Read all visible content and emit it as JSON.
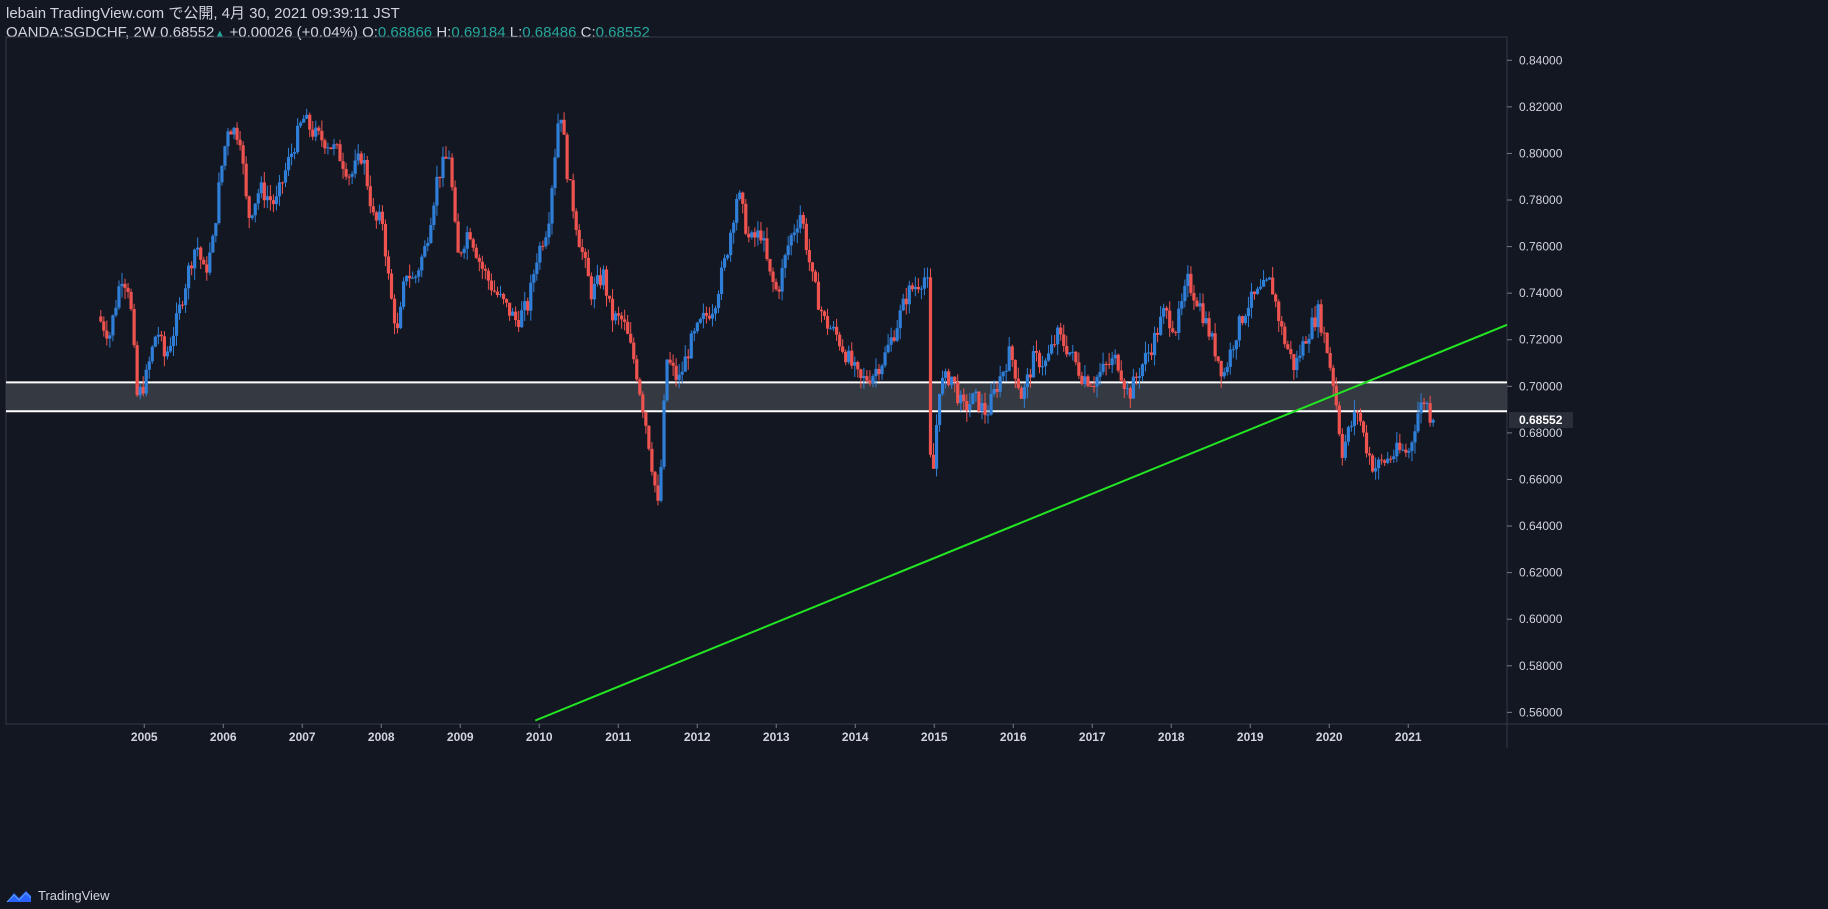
{
  "header": {
    "publisher": "lebain TradingView.com で公開, 4月 30, 2021 09:39:11 JST",
    "symbol_interval_price": "OANDA:SGDCHF, 2W 0.68552",
    "change": "+0.00026 (+0.04%)",
    "open_label": "O:",
    "open_value": "0.68866",
    "high_label": "H:",
    "high_value": "0.69184",
    "low_label": "L:",
    "low_value": "0.68486",
    "close_label": "C:",
    "close_value": "0.68552"
  },
  "footer": {
    "brand": "TradingView"
  },
  "colors": {
    "background": "#131722",
    "up_candle": "#2f7fd8",
    "down_candle": "#ef5350",
    "trendline": "#22e622",
    "zone_fill": "#3a3d45",
    "zone_lines": "#ffffff",
    "axis_text": "#d1d4dc"
  },
  "chart_data": {
    "type": "candlestick",
    "symbol": "OANDA:SGDCHF",
    "interval": "2W",
    "ylim": [
      0.555,
      0.85
    ],
    "y_ticks": [
      "0.84000",
      "0.82000",
      "0.80000",
      "0.78000",
      "0.76000",
      "0.74000",
      "0.72000",
      "0.70000",
      "0.68000",
      "0.66000",
      "0.64000",
      "0.62000",
      "0.60000",
      "0.58000",
      "0.56000"
    ],
    "x_ticks": [
      "2005",
      "2006",
      "2007",
      "2008",
      "2009",
      "2010",
      "2011",
      "2012",
      "2013",
      "2014",
      "2015",
      "2016",
      "2017",
      "2018",
      "2019",
      "2020",
      "2021"
    ],
    "last_price_label": "0.68552",
    "last_price": 0.68552,
    "price_path": [
      [
        2004.45,
        0.73
      ],
      [
        2004.6,
        0.722
      ],
      [
        2004.75,
        0.748
      ],
      [
        2004.85,
        0.742
      ],
      [
        2004.95,
        0.695
      ],
      [
        2005.05,
        0.702
      ],
      [
        2005.2,
        0.725
      ],
      [
        2005.3,
        0.712
      ],
      [
        2005.45,
        0.728
      ],
      [
        2005.6,
        0.75
      ],
      [
        2005.7,
        0.762
      ],
      [
        2005.8,
        0.748
      ],
      [
        2005.9,
        0.76
      ],
      [
        2006.0,
        0.79
      ],
      [
        2006.1,
        0.812
      ],
      [
        2006.25,
        0.808
      ],
      [
        2006.35,
        0.772
      ],
      [
        2006.5,
        0.785
      ],
      [
        2006.7,
        0.778
      ],
      [
        2006.85,
        0.795
      ],
      [
        2007.05,
        0.815
      ],
      [
        2007.2,
        0.808
      ],
      [
        2007.35,
        0.805
      ],
      [
        2007.5,
        0.8
      ],
      [
        2007.65,
        0.79
      ],
      [
        2007.8,
        0.8
      ],
      [
        2007.95,
        0.77
      ],
      [
        2008.05,
        0.772
      ],
      [
        2008.15,
        0.74
      ],
      [
        2008.25,
        0.722
      ],
      [
        2008.35,
        0.75
      ],
      [
        2008.45,
        0.745
      ],
      [
        2008.6,
        0.76
      ],
      [
        2008.75,
        0.79
      ],
      [
        2008.9,
        0.8
      ],
      [
        2009.0,
        0.755
      ],
      [
        2009.15,
        0.768
      ],
      [
        2009.3,
        0.752
      ],
      [
        2009.45,
        0.742
      ],
      [
        2009.6,
        0.735
      ],
      [
        2009.75,
        0.728
      ],
      [
        2009.9,
        0.735
      ],
      [
        2010.0,
        0.755
      ],
      [
        2010.15,
        0.77
      ],
      [
        2010.3,
        0.822
      ],
      [
        2010.4,
        0.79
      ],
      [
        2010.55,
        0.762
      ],
      [
        2010.7,
        0.74
      ],
      [
        2010.85,
        0.748
      ],
      [
        2010.95,
        0.73
      ],
      [
        2011.1,
        0.728
      ],
      [
        2011.25,
        0.71
      ],
      [
        2011.4,
        0.682
      ],
      [
        2011.55,
        0.646
      ],
      [
        2011.65,
        0.712
      ],
      [
        2011.8,
        0.702
      ],
      [
        2011.95,
        0.718
      ],
      [
        2012.1,
        0.728
      ],
      [
        2012.25,
        0.735
      ],
      [
        2012.4,
        0.755
      ],
      [
        2012.55,
        0.784
      ],
      [
        2012.7,
        0.762
      ],
      [
        2012.85,
        0.766
      ],
      [
        2012.95,
        0.748
      ],
      [
        2013.05,
        0.74
      ],
      [
        2013.2,
        0.762
      ],
      [
        2013.35,
        0.775
      ],
      [
        2013.5,
        0.745
      ],
      [
        2013.65,
        0.728
      ],
      [
        2013.8,
        0.722
      ],
      [
        2013.95,
        0.712
      ],
      [
        2014.1,
        0.702
      ],
      [
        2014.25,
        0.705
      ],
      [
        2014.4,
        0.712
      ],
      [
        2014.55,
        0.725
      ],
      [
        2014.7,
        0.74
      ],
      [
        2014.85,
        0.745
      ],
      [
        2014.95,
        0.748
      ],
      [
        2015.0,
        0.65
      ],
      [
        2015.1,
        0.7
      ],
      [
        2015.25,
        0.705
      ],
      [
        2015.4,
        0.69
      ],
      [
        2015.55,
        0.695
      ],
      [
        2015.7,
        0.688
      ],
      [
        2015.85,
        0.702
      ],
      [
        2016.0,
        0.715
      ],
      [
        2016.15,
        0.695
      ],
      [
        2016.3,
        0.712
      ],
      [
        2016.45,
        0.71
      ],
      [
        2016.6,
        0.722
      ],
      [
        2016.75,
        0.715
      ],
      [
        2016.9,
        0.705
      ],
      [
        2017.05,
        0.702
      ],
      [
        2017.2,
        0.708
      ],
      [
        2017.35,
        0.712
      ],
      [
        2017.5,
        0.696
      ],
      [
        2017.65,
        0.708
      ],
      [
        2017.8,
        0.718
      ],
      [
        2017.95,
        0.732
      ],
      [
        2018.1,
        0.725
      ],
      [
        2018.25,
        0.745
      ],
      [
        2018.4,
        0.735
      ],
      [
        2018.55,
        0.72
      ],
      [
        2018.7,
        0.705
      ],
      [
        2018.85,
        0.722
      ],
      [
        2019.0,
        0.735
      ],
      [
        2019.15,
        0.74
      ],
      [
        2019.3,
        0.745
      ],
      [
        2019.45,
        0.722
      ],
      [
        2019.6,
        0.708
      ],
      [
        2019.75,
        0.722
      ],
      [
        2019.9,
        0.732
      ],
      [
        2020.0,
        0.718
      ],
      [
        2020.1,
        0.7
      ],
      [
        2020.2,
        0.672
      ],
      [
        2020.3,
        0.682
      ],
      [
        2020.4,
        0.69
      ],
      [
        2020.5,
        0.675
      ],
      [
        2020.6,
        0.665
      ],
      [
        2020.75,
        0.668
      ],
      [
        2020.9,
        0.672
      ],
      [
        2021.05,
        0.672
      ],
      [
        2021.15,
        0.688
      ],
      [
        2021.25,
        0.695
      ],
      [
        2021.33,
        0.686
      ]
    ],
    "annotations": {
      "horizontal_zone": {
        "top": 0.7017,
        "bottom": 0.6893
      },
      "trendline": {
        "start": [
          2009.95,
          0.5565
        ],
        "end": [
          2022.25,
          0.7264
        ]
      }
    }
  }
}
